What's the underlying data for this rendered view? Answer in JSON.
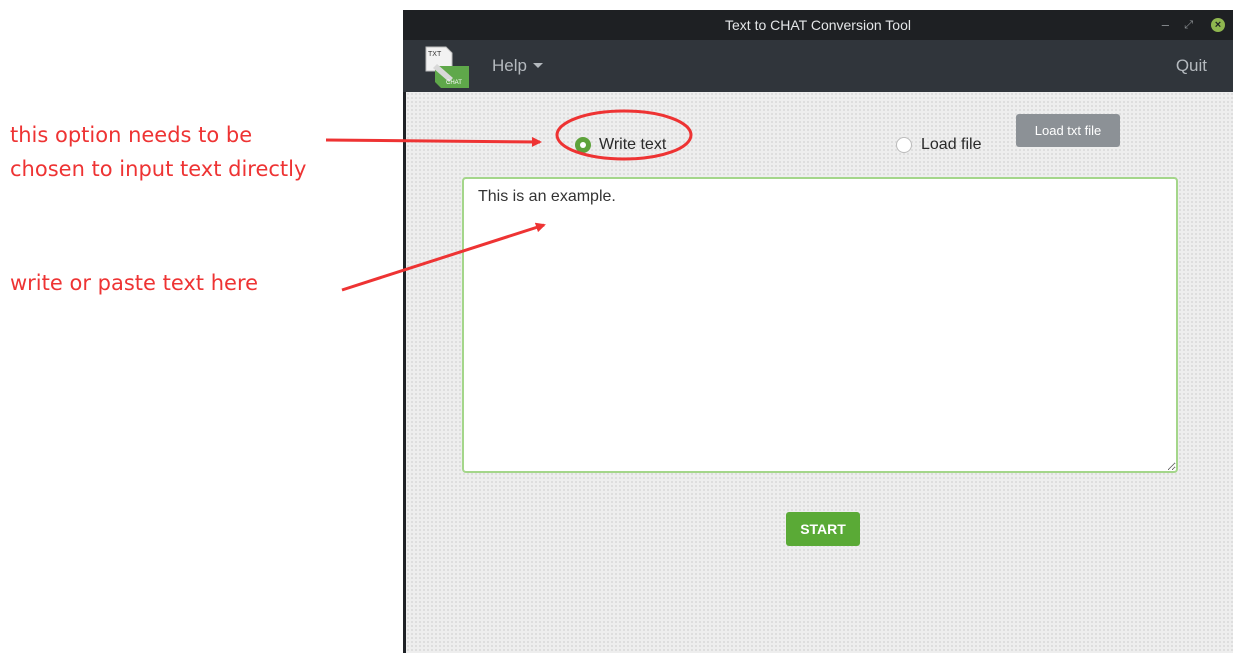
{
  "annotations": {
    "note_option": [
      "this option needs to be",
      "chosen to input text directly"
    ],
    "note_textarea": "write or paste text here",
    "color": "#ee3333"
  },
  "window": {
    "title": "Text to CHAT Conversion Tool",
    "controls": {
      "minimize": "–",
      "maximize": "⤢",
      "close": "×"
    }
  },
  "menubar": {
    "logo": {
      "top_text": "TXT",
      "bottom_text": "CHAT",
      "icon": "txt-to-chat-logo"
    },
    "help": "Help",
    "quit": "Quit"
  },
  "input_mode": {
    "options": [
      {
        "label": "Write text",
        "selected": true
      },
      {
        "label": "Load file",
        "selected": false
      }
    ],
    "load_button": "Load txt file"
  },
  "editor": {
    "value": "This is an example.",
    "accent": "#a4d68a"
  },
  "start_button": "START",
  "colors": {
    "accent_green": "#5aaa36",
    "menubar": "#30353b",
    "titlebar": "#1e2023"
  }
}
